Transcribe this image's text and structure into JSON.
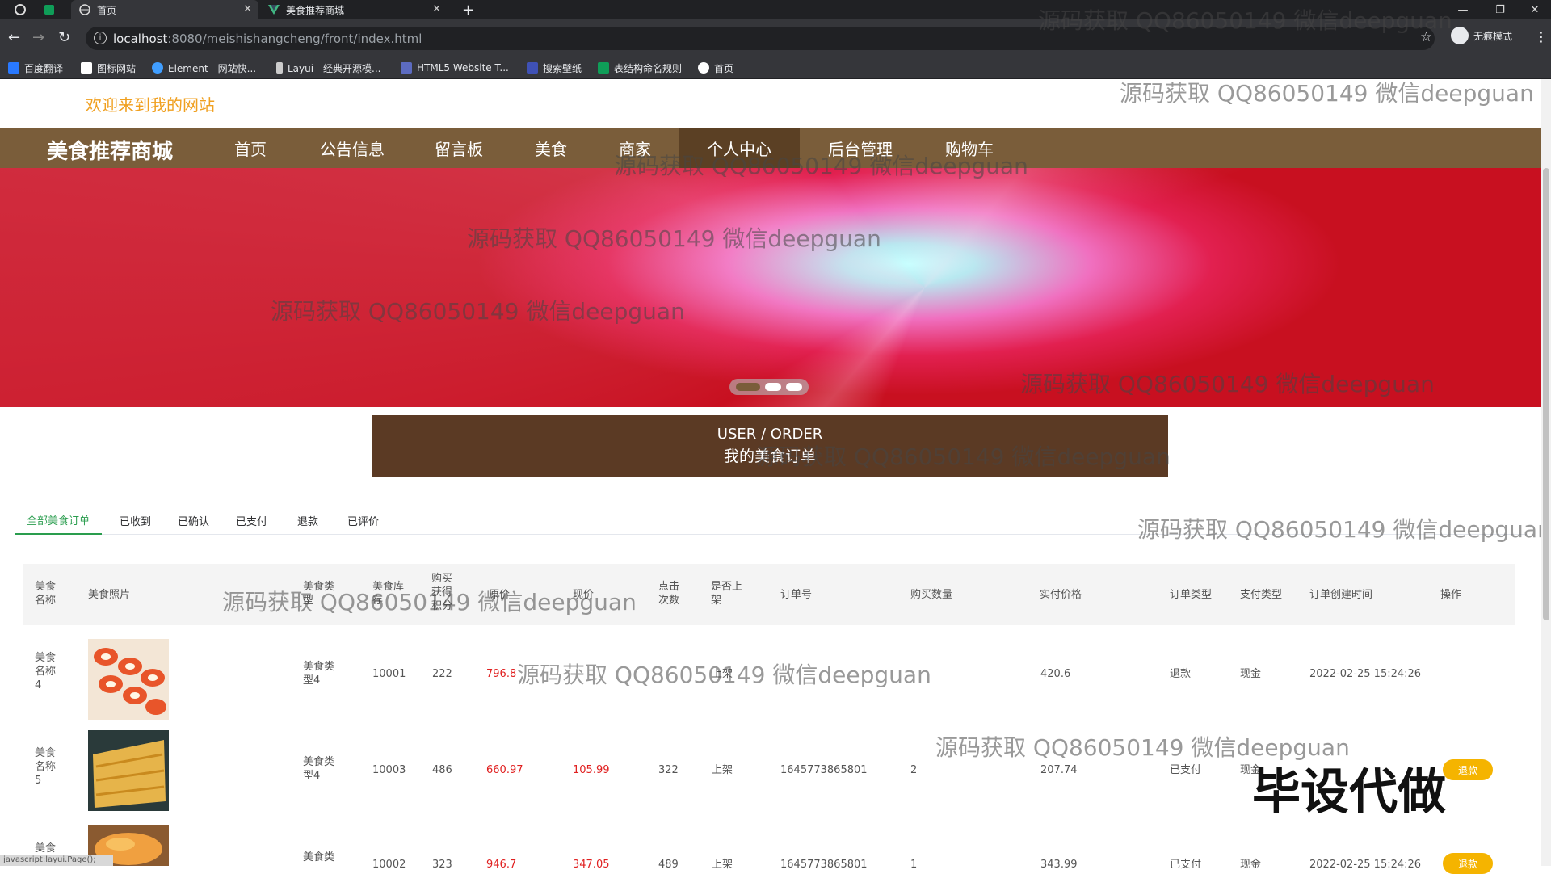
{
  "browser": {
    "tabs": [
      {
        "title": "首页"
      },
      {
        "title": "美食推荐商城"
      }
    ],
    "new_tab_label": "+",
    "url_host": "localhost",
    "url_path": ":8080/meishishangcheng/front/index.html",
    "incognito_label": "无痕模式",
    "bookmarks": [
      {
        "label": "百度翻译",
        "color": "#2979ff"
      },
      {
        "label": "图标网站",
        "color": "#ffffff"
      },
      {
        "label": "Element - 网站快...",
        "color": "#409eff"
      },
      {
        "label": "Layui - 经典开源模...",
        "color": "#cccccc"
      },
      {
        "label": "HTML5 Website T...",
        "color": "#5c6bc0"
      },
      {
        "label": "搜索壁纸",
        "color": "#3f51b5"
      },
      {
        "label": "表结构命名规则",
        "color": "#0f9d58"
      },
      {
        "label": "首页",
        "color": "#ffffff"
      }
    ]
  },
  "site": {
    "welcome": "欢迎来到我的网站",
    "brand": "美食推荐商城",
    "nav": [
      "首页",
      "公告信息",
      "留言板",
      "美食",
      "商家",
      "个人中心",
      "后台管理",
      "购物车"
    ],
    "active_nav": "个人中心",
    "nav_color": "#7a5d3a"
  },
  "order_section": {
    "title_en": "USER / ORDER",
    "title_cn": "我的美食订单",
    "tabs": [
      "全部美食订单",
      "已收到",
      "已确认",
      "已支付",
      "退款",
      "已评价"
    ],
    "active_tab": "全部美食订单"
  },
  "table": {
    "headers": [
      "美食名称",
      "美食照片",
      "美食类型",
      "美食库存",
      "购买获得积分",
      "原价",
      "现价",
      "点击次数",
      "是否上架",
      "订单号",
      "购买数量",
      "实付价格",
      "订单类型",
      "支付类型",
      "订单创建时间",
      "操作"
    ],
    "rows": [
      {
        "name": "美食名称4",
        "type": "美食类型4",
        "stock": "10001",
        "points": "222",
        "orig_price": "796.8",
        "price": "",
        "clicks": "",
        "onsale": "上架",
        "order_no": "",
        "qty": "",
        "paid": "420.6",
        "order_type": "退款",
        "pay_type": "现金",
        "created": "2022-02-25 15:24:26",
        "op": ""
      },
      {
        "name": "美食名称5",
        "type": "美食类型4",
        "stock": "10003",
        "points": "486",
        "orig_price": "660.97",
        "price": "105.99",
        "clicks": "322",
        "onsale": "上架",
        "order_no": "1645773865801",
        "qty": "2",
        "paid": "207.74",
        "order_type": "已支付",
        "pay_type": "现金",
        "created": "",
        "op": "退款"
      },
      {
        "name": "美食",
        "type": "美食类",
        "stock": "10002",
        "points": "323",
        "orig_price": "946.7",
        "price": "347.05",
        "clicks": "489",
        "onsale": "上架",
        "order_no": "1645773865801",
        "qty": "1",
        "paid": "343.99",
        "order_type": "已支付",
        "pay_type": "现金",
        "created": "2022-02-25 15:24:26",
        "op": "退款"
      }
    ]
  },
  "watermark": "源码获取 QQ86050149 微信deepguan",
  "corner_mark": "毕设代做",
  "status_text": "javascript:layui.Page();"
}
